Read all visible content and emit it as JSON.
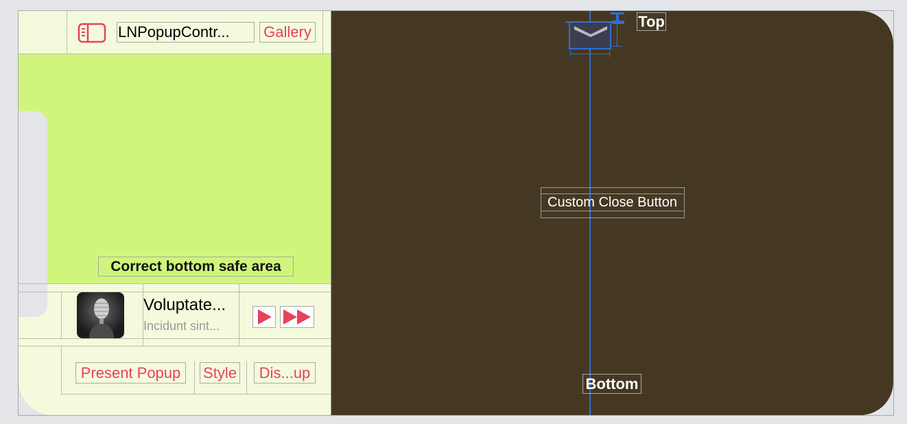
{
  "navigation_bar": {
    "title": "LNPopupContr...",
    "gallery_label": "Gallery"
  },
  "content": {
    "bottom_safe_area_label": "Correct bottom safe area"
  },
  "popup_bar": {
    "song_title": "Voluptate...",
    "song_subtitle": "Incidunt sint...",
    "play_icon": "play-icon",
    "forward_icon": "fast-forward-icon"
  },
  "toolbar": {
    "present_label": "Present Popup",
    "style_label": "Style",
    "dismiss_label": "Dis...up"
  },
  "popup_scene": {
    "top_label": "Top",
    "close_button_label": "Custom Close Button",
    "bottom_label": "Bottom"
  },
  "colors": {
    "tint": "#e8425a",
    "green_background": "#d0f57c",
    "scene_background": "#453823",
    "constraint_blue": "#2f6fd8"
  }
}
